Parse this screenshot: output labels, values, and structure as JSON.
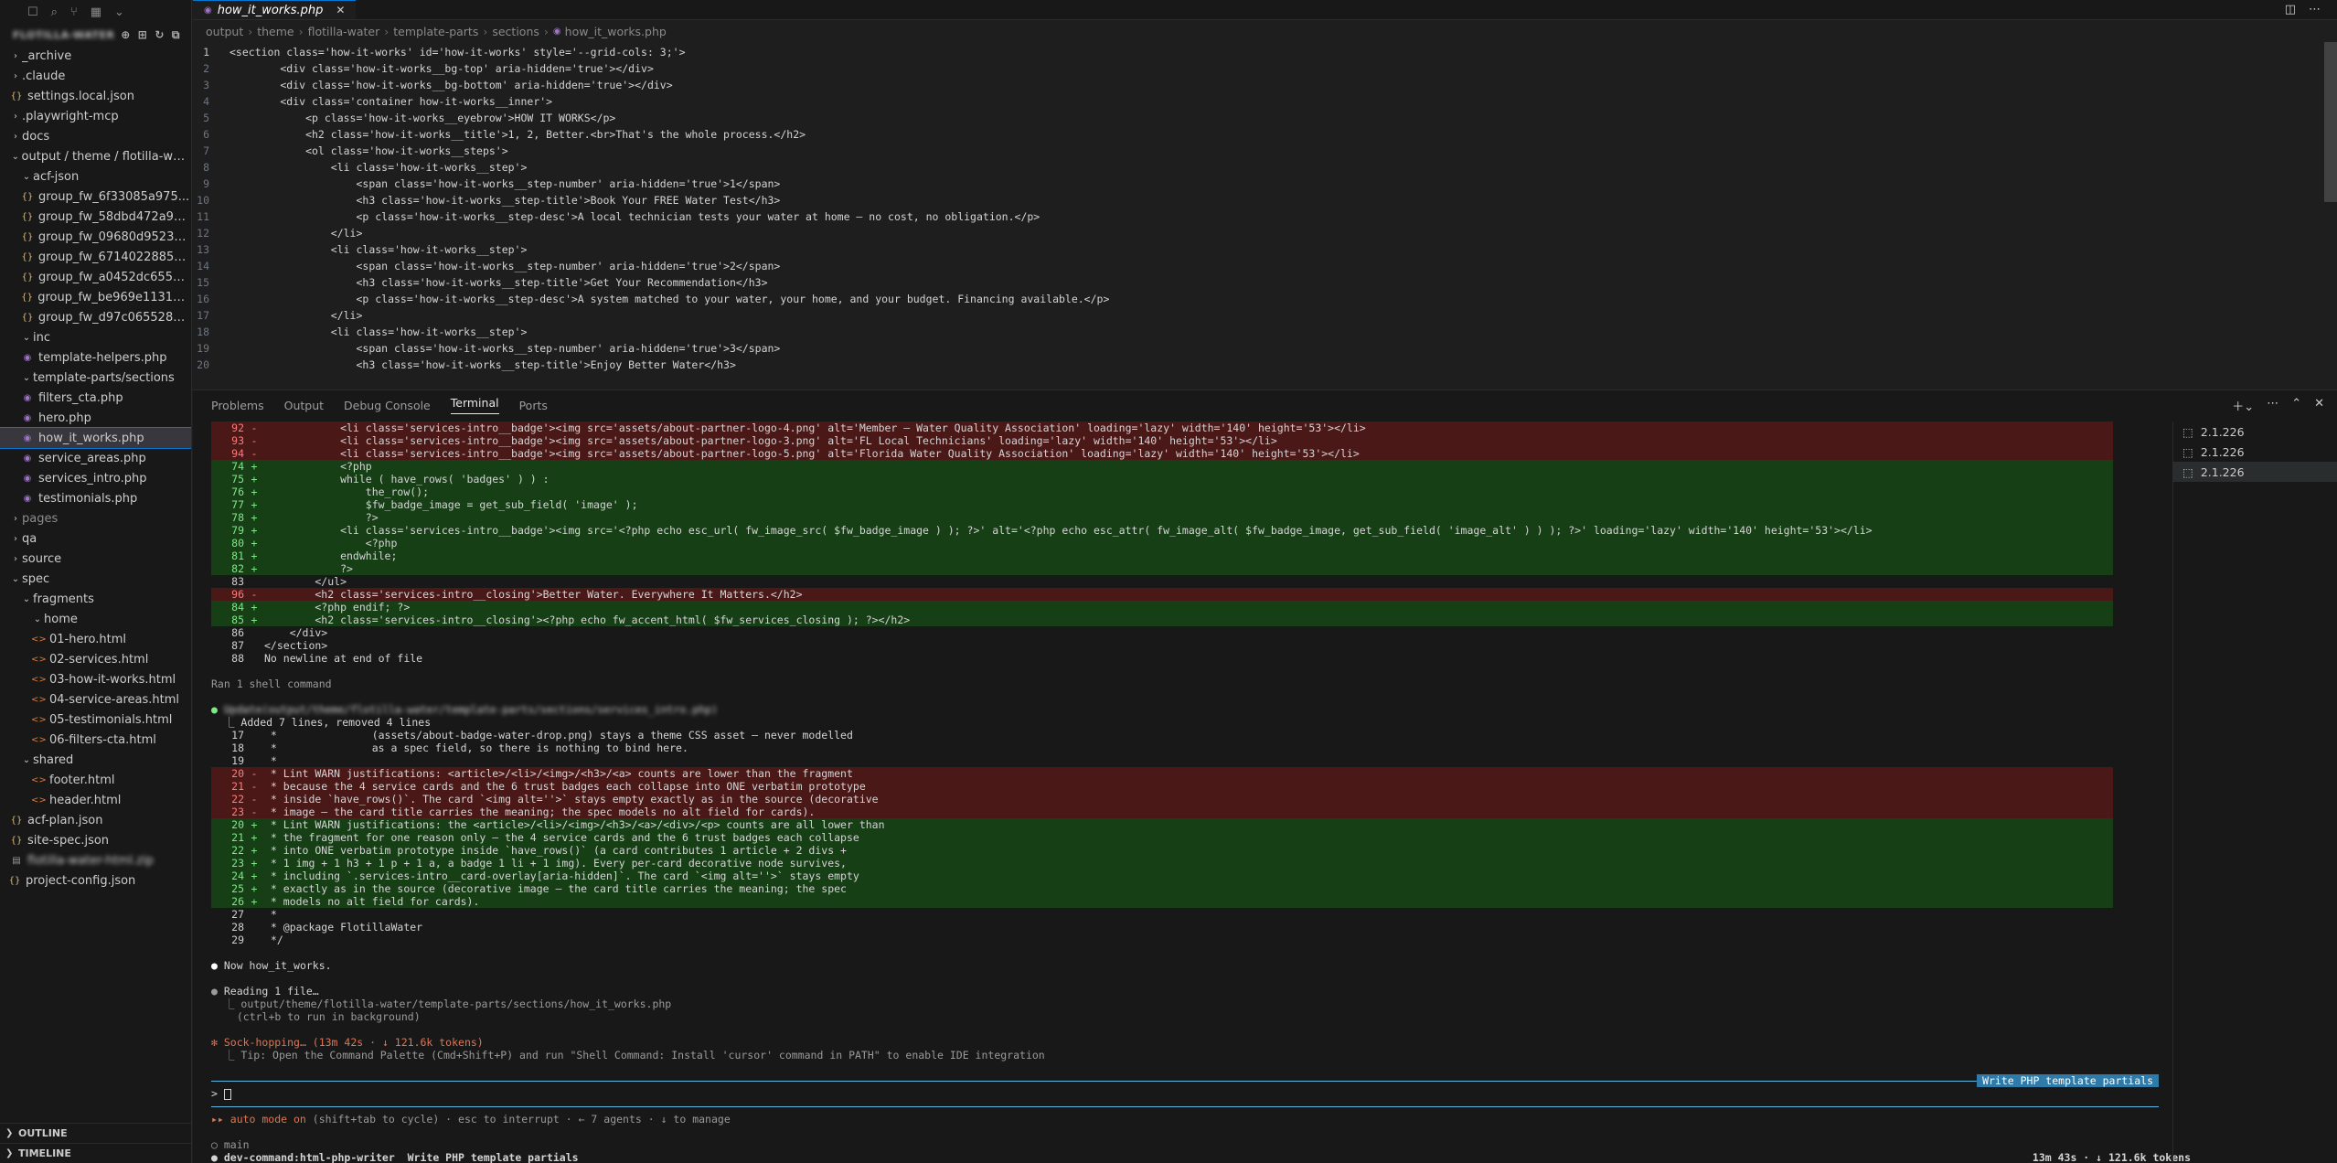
{
  "sidebar": {
    "header_title": "FLOTILLA-WATER",
    "toolbar_icons": [
      "files-icon",
      "search-icon",
      "source-control-icon",
      "extensions-icon",
      "chevron-down-icon"
    ],
    "tree": [
      {
        "label": "_archive",
        "depth": 0,
        "type": "folder",
        "open": false
      },
      {
        "label": ".claude",
        "depth": 0,
        "type": "folder",
        "open": false
      },
      {
        "label": "settings.local.json",
        "depth": 0,
        "type": "json"
      },
      {
        "label": ".playwright-mcp",
        "depth": 0,
        "type": "folder",
        "open": false
      },
      {
        "label": "docs",
        "depth": 0,
        "type": "folder",
        "open": false
      },
      {
        "label": "output / theme / flotilla-water",
        "depth": 0,
        "type": "folder",
        "open": true
      },
      {
        "label": "acf-json",
        "depth": 1,
        "type": "folder",
        "open": true
      },
      {
        "label": "group_fw_6f33085a975...",
        "depth": 1,
        "type": "json"
      },
      {
        "label": "group_fw_58dbd472a9b...",
        "depth": 1,
        "type": "json"
      },
      {
        "label": "group_fw_09680d9523c...",
        "depth": 1,
        "type": "json"
      },
      {
        "label": "group_fw_6714022885b...",
        "depth": 1,
        "type": "json"
      },
      {
        "label": "group_fw_a0452dc655a...",
        "depth": 1,
        "type": "json"
      },
      {
        "label": "group_fw_be969e113135...",
        "depth": 1,
        "type": "json"
      },
      {
        "label": "group_fw_d97c0655286...",
        "depth": 1,
        "type": "json"
      },
      {
        "label": "inc",
        "depth": 1,
        "type": "folder",
        "open": true
      },
      {
        "label": "template-helpers.php",
        "depth": 1,
        "type": "php"
      },
      {
        "label": "template-parts/sections",
        "depth": 1,
        "type": "folder",
        "open": true
      },
      {
        "label": "filters_cta.php",
        "depth": 1,
        "type": "php"
      },
      {
        "label": "hero.php",
        "depth": 1,
        "type": "php"
      },
      {
        "label": "how_it_works.php",
        "depth": 1,
        "type": "php",
        "active": true
      },
      {
        "label": "service_areas.php",
        "depth": 1,
        "type": "php"
      },
      {
        "label": "services_intro.php",
        "depth": 1,
        "type": "php"
      },
      {
        "label": "testimonials.php",
        "depth": 1,
        "type": "php"
      },
      {
        "label": "pages",
        "depth": 0,
        "type": "folder",
        "open": false,
        "dim": true
      },
      {
        "label": "qa",
        "depth": 0,
        "type": "folder",
        "open": false
      },
      {
        "label": "source",
        "depth": 0,
        "type": "folder",
        "open": false
      },
      {
        "label": "spec",
        "depth": 0,
        "type": "folder",
        "open": true
      },
      {
        "label": "fragments",
        "depth": 1,
        "type": "folder",
        "open": true
      },
      {
        "label": "home",
        "depth": 2,
        "type": "folder",
        "open": true
      },
      {
        "label": "01-hero.html",
        "depth": 2,
        "type": "html"
      },
      {
        "label": "02-services.html",
        "depth": 2,
        "type": "html"
      },
      {
        "label": "03-how-it-works.html",
        "depth": 2,
        "type": "html"
      },
      {
        "label": "04-service-areas.html",
        "depth": 2,
        "type": "html"
      },
      {
        "label": "05-testimonials.html",
        "depth": 2,
        "type": "html"
      },
      {
        "label": "06-filters-cta.html",
        "depth": 2,
        "type": "html"
      },
      {
        "label": "shared",
        "depth": 1,
        "type": "folder",
        "open": true
      },
      {
        "label": "footer.html",
        "depth": 2,
        "type": "html"
      },
      {
        "label": "header.html",
        "depth": 2,
        "type": "html"
      },
      {
        "label": "acf-plan.json",
        "depth": 0,
        "type": "json"
      },
      {
        "label": "site-spec.json",
        "depth": 0,
        "type": "json"
      },
      {
        "label": "flotilla-water-html.zip",
        "depth": 0,
        "type": "zip",
        "blurred": true
      },
      {
        "label": "project-config.json",
        "depth": -1,
        "type": "json"
      }
    ],
    "outline_label": "OUTLINE",
    "timeline_label": "TIMELINE"
  },
  "editor": {
    "tab_title": "how_it_works.php",
    "breadcrumb": [
      "output",
      "theme",
      "flotilla-water",
      "template-parts",
      "sections",
      "how_it_works.php"
    ],
    "lines": [
      "<section class='how-it-works' id='how-it-works' style='--grid-cols: 3;'>",
      "        <div class='how-it-works__bg-top' aria-hidden='true'></div>",
      "        <div class='how-it-works__bg-bottom' aria-hidden='true'></div>",
      "        <div class='container how-it-works__inner'>",
      "            <p class='how-it-works__eyebrow'>HOW IT WORKS</p>",
      "            <h2 class='how-it-works__title'>1, 2, Better.<br>That's the whole process.</h2>",
      "            <ol class='how-it-works__steps'>",
      "                <li class='how-it-works__step'>",
      "                    <span class='how-it-works__step-number' aria-hidden='true'>1</span>",
      "                    <h3 class='how-it-works__step-title'>Book Your FREE Water Test</h3>",
      "                    <p class='how-it-works__step-desc'>A local technician tests your water at home — no cost, no obligation.</p>",
      "                </li>",
      "                <li class='how-it-works__step'>",
      "                    <span class='how-it-works__step-number' aria-hidden='true'>2</span>",
      "                    <h3 class='how-it-works__step-title'>Get Your Recommendation</h3>",
      "                    <p class='how-it-works__step-desc'>A system matched to your water, your home, and your budget. Financing available.</p>",
      "                </li>",
      "                <li class='how-it-works__step'>",
      "                    <span class='how-it-works__step-number' aria-hidden='true'>3</span>",
      "                    <h3 class='how-it-works__step-title'>Enjoy Better Water</h3>"
    ]
  },
  "panel": {
    "tabs": [
      "Problems",
      "Output",
      "Debug Console",
      "Terminal",
      "Ports"
    ],
    "active_tab": "Terminal",
    "terminals": [
      "2.1.226",
      "2.1.226",
      "2.1.226"
    ]
  },
  "terminal": {
    "diff1": [
      {
        "n": "92",
        "m": "-",
        "t": "del",
        "c": "            <li class='services-intro__badge'><img src='assets/about-partner-logo-4.png' alt='Member — Water Quality Association' loading='lazy' width='140' height='53'></li>"
      },
      {
        "n": "93",
        "m": "-",
        "t": "del",
        "c": "            <li class='services-intro__badge'><img src='assets/about-partner-logo-3.png' alt='FL Local Technicians' loading='lazy' width='140' height='53'></li>"
      },
      {
        "n": "94",
        "m": "-",
        "t": "del",
        "c": "            <li class='services-intro__badge'><img src='assets/about-partner-logo-5.png' alt='Florida Water Quality Association' loading='lazy' width='140' height='53'></li>"
      },
      {
        "n": "74",
        "m": "+",
        "t": "add",
        "c": "            <?php"
      },
      {
        "n": "75",
        "m": "+",
        "t": "add",
        "c": "            while ( have_rows( 'badges' ) ) :"
      },
      {
        "n": "76",
        "m": "+",
        "t": "add",
        "c": "                the_row();"
      },
      {
        "n": "77",
        "m": "+",
        "t": "add",
        "c": "                $fw_badge_image = get_sub_field( 'image' );"
      },
      {
        "n": "78",
        "m": "+",
        "t": "add",
        "c": "                ?>"
      },
      {
        "n": "79",
        "m": "+",
        "t": "add",
        "c": "            <li class='services-intro__badge'><img src='<?php echo esc_url( fw_image_src( $fw_badge_image ) ); ?>' alt='<?php echo esc_attr( fw_image_alt( $fw_badge_image, get_sub_field( 'image_alt' ) ) ); ?>' loading='lazy' width='140' height='53'></li>"
      },
      {
        "n": "80",
        "m": "+",
        "t": "add",
        "c": "                <?php"
      },
      {
        "n": "81",
        "m": "+",
        "t": "add",
        "c": "            endwhile;"
      },
      {
        "n": "82",
        "m": "+",
        "t": "add",
        "c": "            ?>"
      },
      {
        "n": "83",
        "m": " ",
        "t": "ctx",
        "c": "        </ul>"
      },
      {
        "n": "96",
        "m": "-",
        "t": "del",
        "c": "        <h2 class='services-intro__closing'>Better Water. Everywhere It Matters.</h2>"
      },
      {
        "n": "84",
        "m": "+",
        "t": "add",
        "c": "        <?php endif; ?>"
      },
      {
        "n": "85",
        "m": "+",
        "t": "add",
        "c": "        <h2 class='services-intro__closing'><?php echo fw_accent_html( $fw_services_closing ); ?></h2>"
      },
      {
        "n": "86",
        "m": " ",
        "t": "ctx",
        "c": "    </div>"
      },
      {
        "n": "87",
        "m": " ",
        "t": "ctx",
        "c": "</section>"
      },
      {
        "n": "88",
        "m": " ",
        "t": "ctx",
        "c": "No newline at end of file"
      }
    ],
    "ran_shell": "Ran 1 shell command",
    "update_label": "Update(output/theme/flotilla-water/template-parts/sections/services_intro.php)",
    "added_summary": "⎿ Added 7 lines, removed 4 lines",
    "diff2": [
      {
        "n": "17",
        "m": " ",
        "t": "ctx",
        "c": " *               (assets/about-badge-water-drop.png) stays a theme CSS asset — never modelled"
      },
      {
        "n": "18",
        "m": " ",
        "t": "ctx",
        "c": " *               as a spec field, so there is nothing to bind here."
      },
      {
        "n": "19",
        "m": " ",
        "t": "ctx",
        "c": " *"
      },
      {
        "n": "20",
        "m": "-",
        "t": "del",
        "c": " * Lint WARN justifications: <article>/<li>/<img>/<h3>/<a> counts are lower than the fragment"
      },
      {
        "n": "21",
        "m": "-",
        "t": "del",
        "c": " * because the 4 service cards and the 6 trust badges each collapse into ONE verbatim prototype"
      },
      {
        "n": "22",
        "m": "-",
        "t": "del",
        "c": " * inside `have_rows()`. The card `<img alt=''>` stays empty exactly as in the source (decorative"
      },
      {
        "n": "23",
        "m": "-",
        "t": "del",
        "c": " * image — the card title carries the meaning; the spec models no alt field for cards)."
      },
      {
        "n": "20",
        "m": "+",
        "t": "add",
        "c": " * Lint WARN justifications: the <article>/<li>/<img>/<h3>/<a>/<div>/<p> counts are all lower than"
      },
      {
        "n": "21",
        "m": "+",
        "t": "add",
        "c": " * the fragment for one reason only — the 4 service cards and the 6 trust badges each collapse"
      },
      {
        "n": "22",
        "m": "+",
        "t": "add",
        "c": " * into ONE verbatim prototype inside `have_rows()` (a card contributes 1 article + 2 divs +"
      },
      {
        "n": "23",
        "m": "+",
        "t": "add",
        "c": " * 1 img + 1 h3 + 1 p + 1 a, a badge 1 li + 1 img). Every per-card decorative node survives,"
      },
      {
        "n": "24",
        "m": "+",
        "t": "add",
        "c": " * including `.services-intro__card-overlay[aria-hidden]`. The card `<img alt=''>` stays empty"
      },
      {
        "n": "25",
        "m": "+",
        "t": "add",
        "c": " * exactly as in the source (decorative image — the card title carries the meaning; the spec"
      },
      {
        "n": "26",
        "m": "+",
        "t": "add",
        "c": " * models no alt field for cards)."
      },
      {
        "n": "27",
        "m": " ",
        "t": "ctx",
        "c": " *"
      },
      {
        "n": "28",
        "m": " ",
        "t": "ctx",
        "c": " * @package FlotillaWater"
      },
      {
        "n": "29",
        "m": " ",
        "t": "ctx",
        "c": " */"
      }
    ],
    "now_line": "Now how_it_works.",
    "reading_line": "Reading 1 file…",
    "reading_path": "⎿ output/theme/flotilla-water/template-parts/sections/how_it_works.php",
    "reading_hint": "  (ctrl+b to run in background)",
    "sock_hopping": "Sock-hopping… (13m 42s · ↓ 121.6k tokens)",
    "tip": "⎿ Tip: Open the Command Palette (Cmd+Shift+P) and run \"Shell Command: Install 'cursor' command in PATH\" to enable IDE integration",
    "task_badge": "Write PHP template partials",
    "prompt": "> ",
    "auto_mode_label": "▸▸ auto mode on",
    "auto_mode_rest": " (shift+tab to cycle) · esc to interrupt · ← 7 agents · ↓ to manage",
    "branch_line": "○ main",
    "agent_line": "● dev-command:html-php-writer  Write PHP template partials",
    "status_right": "13m 43s · ↓ 121.6k tokens"
  },
  "colors": {
    "accent": "#0078d4",
    "diff_del_bg": "#4b1818",
    "diff_add_bg": "#173f16",
    "claude_orange": "#d97757",
    "task_badge_bg": "#2e7aa8"
  }
}
